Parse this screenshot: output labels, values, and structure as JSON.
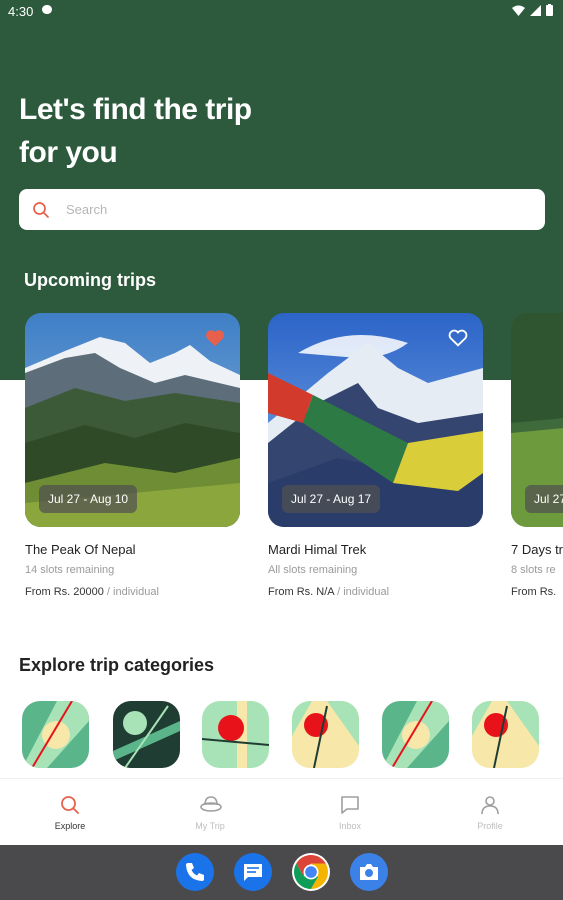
{
  "status_bar": {
    "time": "4:30"
  },
  "header": {
    "headline_line1": "Let's find the trip",
    "headline_line2": "for you"
  },
  "search": {
    "placeholder": "Search"
  },
  "upcoming": {
    "title": "Upcoming trips",
    "trips": [
      {
        "name": "The Peak Of Nepal",
        "dates": "Jul 27 - Aug 10",
        "slots": "14 slots remaining",
        "price_prefix": "From Rs. 20000",
        "price_sep": " / ",
        "price_unit": "individual",
        "favorited": true
      },
      {
        "name": "Mardi Himal Trek",
        "dates": "Jul 27 - Aug 17",
        "slots": "All slots remaining",
        "price_prefix": "From Rs. N/A",
        "price_sep": " / ",
        "price_unit": "individual",
        "favorited": false
      },
      {
        "name": "7 Days tr",
        "dates": "Jul 27",
        "slots": "8 slots re",
        "price_prefix": "From Rs.",
        "price_sep": "",
        "price_unit": "",
        "favorited": false
      }
    ]
  },
  "explore": {
    "title": "Explore trip categories"
  },
  "bottom_nav": [
    {
      "label": "Explore",
      "icon": "search-icon",
      "active": true
    },
    {
      "label": "My Trip",
      "icon": "hat-icon",
      "active": false
    },
    {
      "label": "Inbox",
      "icon": "chat-icon",
      "active": false
    },
    {
      "label": "Profile",
      "icon": "person-icon",
      "active": false
    }
  ],
  "dock": [
    {
      "icon": "phone-icon"
    },
    {
      "icon": "messages-icon"
    },
    {
      "icon": "chrome-icon"
    },
    {
      "icon": "camera-icon"
    }
  ],
  "colors": {
    "primary": "#2d5a3d",
    "accent": "#e8604c",
    "category_green": "#5bb58a",
    "category_dark": "#1f3d33",
    "category_mint": "#a8e3b8",
    "category_sand": "#f7e7a8",
    "category_red": "#e8121a"
  }
}
